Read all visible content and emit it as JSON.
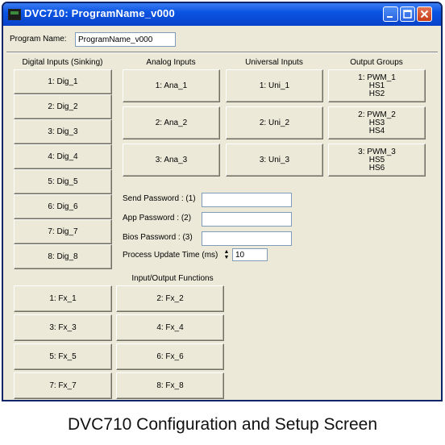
{
  "window": {
    "title": "DVC710: ProgramName_v000"
  },
  "program": {
    "label": "Program Name:",
    "value": "ProgramName_v000"
  },
  "sections": {
    "digital_header": "Digital Inputs (Sinking)",
    "analog_header": "Analog Inputs",
    "universal_header": "Universal Inputs",
    "output_header": "Output Groups",
    "io_header": "Input/Output Functions"
  },
  "digital_inputs": [
    "1: Dig_1",
    "2: Dig_2",
    "3: Dig_3",
    "4: Dig_4",
    "5: Dig_5",
    "6: Dig_6",
    "7: Dig_7",
    "8: Dig_8"
  ],
  "analog_inputs": [
    "1: Ana_1",
    "2: Ana_2",
    "3: Ana_3"
  ],
  "universal_inputs": [
    "1: Uni_1",
    "2: Uni_2",
    "3: Uni_3"
  ],
  "output_groups": [
    "1: PWM_1\nHS1\nHS2",
    "2: PWM_2\nHS3\nHS4",
    "3: PWM_3\nHS5\nHS6"
  ],
  "passwords": {
    "send_label": "Send Password : (1)",
    "send_value": "",
    "app_label": "App Password : (2)",
    "app_value": "",
    "bios_label": "Bios Password : (3)",
    "bios_value": ""
  },
  "process_update": {
    "label": "Process Update Time (ms)",
    "value": "10"
  },
  "io_functions": [
    "1: Fx_1",
    "2: Fx_2",
    "3: Fx_3",
    "4: Fx_4",
    "5: Fx_5",
    "6: Fx_6",
    "7: Fx_7",
    "8: Fx_8"
  ],
  "caption": "DVC710 Configuration and Setup Screen",
  "colors": {
    "titlebar": "#0a54e3",
    "window_bg": "#ece9d8",
    "close_button": "#c83c18"
  }
}
